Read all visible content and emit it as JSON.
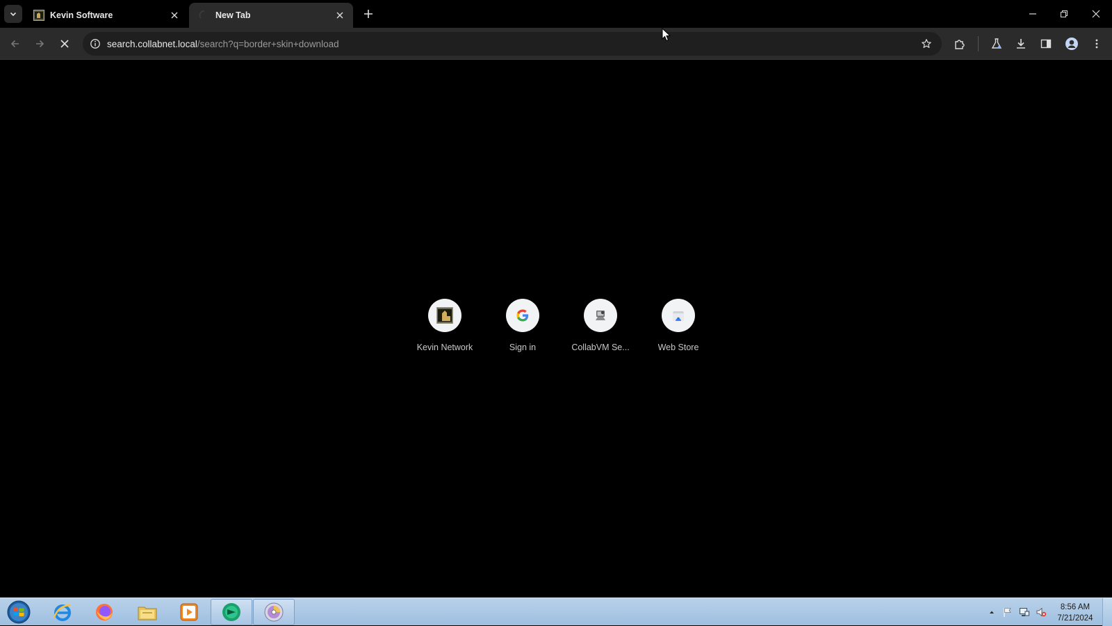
{
  "browser": {
    "tabs": [
      {
        "title": "Kevin Software",
        "active": false,
        "favicon": "kevin-logo-icon"
      },
      {
        "title": "New Tab",
        "active": true,
        "favicon": "loading-spinner-icon"
      }
    ],
    "omnibox": {
      "host": "search.collabnet.local",
      "path": "/search?q=border+skin+download"
    }
  },
  "shortcuts": [
    {
      "label": "Kevin Network",
      "icon": "kevin-logo-icon"
    },
    {
      "label": "Sign in",
      "icon": "google-g-icon"
    },
    {
      "label": "CollabVM Se...",
      "icon": "collabvm-icon"
    },
    {
      "label": "Web Store",
      "icon": "web-store-icon"
    }
  ],
  "taskbar": {
    "items": [
      "start-orb-icon",
      "internet-explorer-icon",
      "firefox-icon",
      "file-explorer-icon",
      "media-player-icon",
      "chrome-app-icon",
      "dvd-maker-icon"
    ],
    "clock": {
      "time": "8:56 AM",
      "date": "7/21/2024"
    }
  },
  "colors": {
    "tab_bg": "#000000",
    "toolbar_bg": "#2b2b2b",
    "omnibox_bg": "#1f1f1f",
    "content_bg": "#000000",
    "taskbar": "#b9d1ea"
  }
}
